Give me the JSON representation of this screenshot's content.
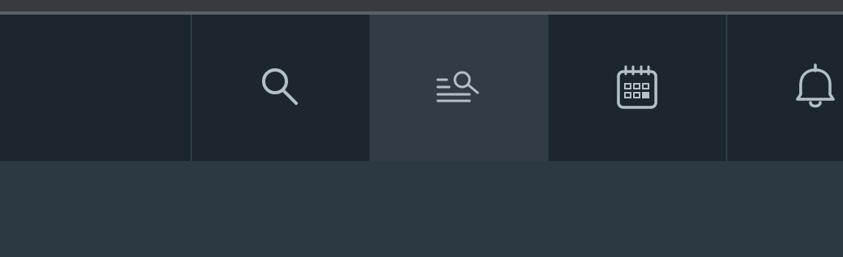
{
  "toolbar": {
    "buttons": [
      {
        "id": "blank",
        "icon": "",
        "active": false
      },
      {
        "id": "search",
        "icon": "search-icon",
        "active": false
      },
      {
        "id": "text-search",
        "icon": "text-search-icon",
        "active": true
      },
      {
        "id": "calendar",
        "icon": "calendar-icon",
        "active": false
      },
      {
        "id": "notifications",
        "icon": "bell-icon",
        "active": false
      }
    ]
  },
  "colors": {
    "toolbar_bg": "#1d252d",
    "active_bg": "#313c46",
    "icon": "#b5bfc8",
    "content_bg": "#2c3842",
    "top_strip": "#373a3e"
  }
}
